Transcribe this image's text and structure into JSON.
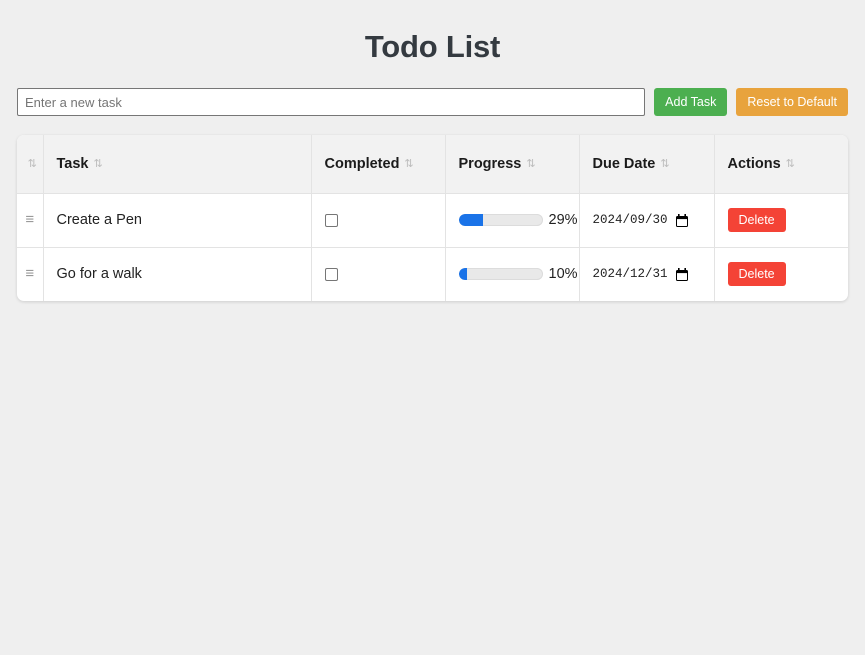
{
  "app": {
    "title": "Todo List",
    "background_color": "#efefef"
  },
  "toolbar": {
    "input_placeholder": "Enter a new task",
    "input_value": "",
    "add_label": "Add Task",
    "add_color": "#4CAF50",
    "reset_label": "Reset to Default",
    "reset_color": "#e8a33d"
  },
  "table": {
    "sort_glyph": "⇅",
    "handle_glyph": "≡",
    "columns": [
      {
        "key": "handle",
        "label": ""
      },
      {
        "key": "task",
        "label": "Task"
      },
      {
        "key": "completed",
        "label": "Completed"
      },
      {
        "key": "progress",
        "label": "Progress"
      },
      {
        "key": "due",
        "label": "Due Date"
      },
      {
        "key": "actions",
        "label": "Actions"
      }
    ],
    "rows": [
      {
        "task": "Create a Pen",
        "completed": false,
        "progress": 29,
        "progress_label": "29%",
        "due_date": "2024/09/30",
        "delete_label": "Delete"
      },
      {
        "task": "Go for a walk",
        "completed": false,
        "progress": 10,
        "progress_label": "10%",
        "due_date": "2024/12/31",
        "delete_label": "Delete"
      }
    ],
    "delete_color": "#f44336",
    "progress_fill_color": "#1a73e8"
  }
}
